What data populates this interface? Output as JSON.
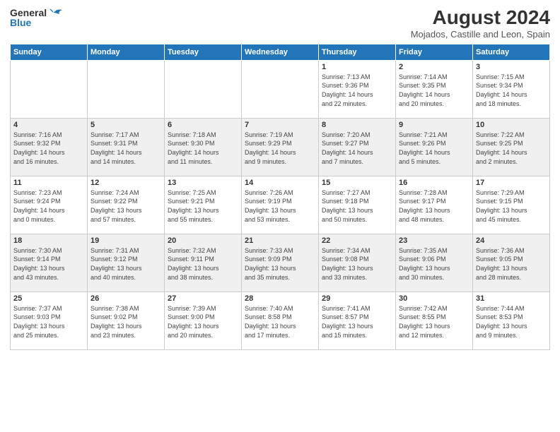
{
  "header": {
    "logo_line1": "General",
    "logo_line2": "Blue",
    "month_title": "August 2024",
    "location": "Mojados, Castille and Leon, Spain"
  },
  "days_of_week": [
    "Sunday",
    "Monday",
    "Tuesday",
    "Wednesday",
    "Thursday",
    "Friday",
    "Saturday"
  ],
  "weeks": [
    [
      {
        "day": "",
        "info": ""
      },
      {
        "day": "",
        "info": ""
      },
      {
        "day": "",
        "info": ""
      },
      {
        "day": "",
        "info": ""
      },
      {
        "day": "1",
        "info": "Sunrise: 7:13 AM\nSunset: 9:36 PM\nDaylight: 14 hours\nand 22 minutes."
      },
      {
        "day": "2",
        "info": "Sunrise: 7:14 AM\nSunset: 9:35 PM\nDaylight: 14 hours\nand 20 minutes."
      },
      {
        "day": "3",
        "info": "Sunrise: 7:15 AM\nSunset: 9:34 PM\nDaylight: 14 hours\nand 18 minutes."
      }
    ],
    [
      {
        "day": "4",
        "info": "Sunrise: 7:16 AM\nSunset: 9:32 PM\nDaylight: 14 hours\nand 16 minutes."
      },
      {
        "day": "5",
        "info": "Sunrise: 7:17 AM\nSunset: 9:31 PM\nDaylight: 14 hours\nand 14 minutes."
      },
      {
        "day": "6",
        "info": "Sunrise: 7:18 AM\nSunset: 9:30 PM\nDaylight: 14 hours\nand 11 minutes."
      },
      {
        "day": "7",
        "info": "Sunrise: 7:19 AM\nSunset: 9:29 PM\nDaylight: 14 hours\nand 9 minutes."
      },
      {
        "day": "8",
        "info": "Sunrise: 7:20 AM\nSunset: 9:27 PM\nDaylight: 14 hours\nand 7 minutes."
      },
      {
        "day": "9",
        "info": "Sunrise: 7:21 AM\nSunset: 9:26 PM\nDaylight: 14 hours\nand 5 minutes."
      },
      {
        "day": "10",
        "info": "Sunrise: 7:22 AM\nSunset: 9:25 PM\nDaylight: 14 hours\nand 2 minutes."
      }
    ],
    [
      {
        "day": "11",
        "info": "Sunrise: 7:23 AM\nSunset: 9:24 PM\nDaylight: 14 hours\nand 0 minutes."
      },
      {
        "day": "12",
        "info": "Sunrise: 7:24 AM\nSunset: 9:22 PM\nDaylight: 13 hours\nand 57 minutes."
      },
      {
        "day": "13",
        "info": "Sunrise: 7:25 AM\nSunset: 9:21 PM\nDaylight: 13 hours\nand 55 minutes."
      },
      {
        "day": "14",
        "info": "Sunrise: 7:26 AM\nSunset: 9:19 PM\nDaylight: 13 hours\nand 53 minutes."
      },
      {
        "day": "15",
        "info": "Sunrise: 7:27 AM\nSunset: 9:18 PM\nDaylight: 13 hours\nand 50 minutes."
      },
      {
        "day": "16",
        "info": "Sunrise: 7:28 AM\nSunset: 9:17 PM\nDaylight: 13 hours\nand 48 minutes."
      },
      {
        "day": "17",
        "info": "Sunrise: 7:29 AM\nSunset: 9:15 PM\nDaylight: 13 hours\nand 45 minutes."
      }
    ],
    [
      {
        "day": "18",
        "info": "Sunrise: 7:30 AM\nSunset: 9:14 PM\nDaylight: 13 hours\nand 43 minutes."
      },
      {
        "day": "19",
        "info": "Sunrise: 7:31 AM\nSunset: 9:12 PM\nDaylight: 13 hours\nand 40 minutes."
      },
      {
        "day": "20",
        "info": "Sunrise: 7:32 AM\nSunset: 9:11 PM\nDaylight: 13 hours\nand 38 minutes."
      },
      {
        "day": "21",
        "info": "Sunrise: 7:33 AM\nSunset: 9:09 PM\nDaylight: 13 hours\nand 35 minutes."
      },
      {
        "day": "22",
        "info": "Sunrise: 7:34 AM\nSunset: 9:08 PM\nDaylight: 13 hours\nand 33 minutes."
      },
      {
        "day": "23",
        "info": "Sunrise: 7:35 AM\nSunset: 9:06 PM\nDaylight: 13 hours\nand 30 minutes."
      },
      {
        "day": "24",
        "info": "Sunrise: 7:36 AM\nSunset: 9:05 PM\nDaylight: 13 hours\nand 28 minutes."
      }
    ],
    [
      {
        "day": "25",
        "info": "Sunrise: 7:37 AM\nSunset: 9:03 PM\nDaylight: 13 hours\nand 25 minutes."
      },
      {
        "day": "26",
        "info": "Sunrise: 7:38 AM\nSunset: 9:02 PM\nDaylight: 13 hours\nand 23 minutes."
      },
      {
        "day": "27",
        "info": "Sunrise: 7:39 AM\nSunset: 9:00 PM\nDaylight: 13 hours\nand 20 minutes."
      },
      {
        "day": "28",
        "info": "Sunrise: 7:40 AM\nSunset: 8:58 PM\nDaylight: 13 hours\nand 17 minutes."
      },
      {
        "day": "29",
        "info": "Sunrise: 7:41 AM\nSunset: 8:57 PM\nDaylight: 13 hours\nand 15 minutes."
      },
      {
        "day": "30",
        "info": "Sunrise: 7:42 AM\nSunset: 8:55 PM\nDaylight: 13 hours\nand 12 minutes."
      },
      {
        "day": "31",
        "info": "Sunrise: 7:44 AM\nSunset: 8:53 PM\nDaylight: 13 hours\nand 9 minutes."
      }
    ]
  ]
}
